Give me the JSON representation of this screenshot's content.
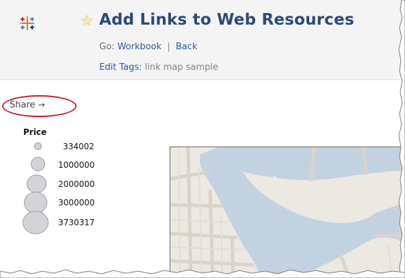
{
  "header": {
    "title": "Add Links to Web Resources",
    "go_label": "Go:",
    "workbook_link": "Workbook",
    "separator": "|",
    "back_link": "Back",
    "tags_label": "Edit Tags:",
    "tags_value": "link map sample"
  },
  "share": {
    "label": "Share",
    "arrow": "→"
  },
  "legend": {
    "title": "Price",
    "items": [
      "334002",
      "1000000",
      "2000000",
      "3000000",
      "3730317"
    ]
  },
  "colors": {
    "title": "#2c4a78",
    "link": "#2d5aa8",
    "highlight_ring": "#c4202d",
    "water": "#c3d2e1",
    "land": "#ece9e2"
  },
  "icons": {
    "logo": "tableau-logo-icon",
    "favorite": "star-icon",
    "share_arrow": "arrow-right-icon"
  }
}
